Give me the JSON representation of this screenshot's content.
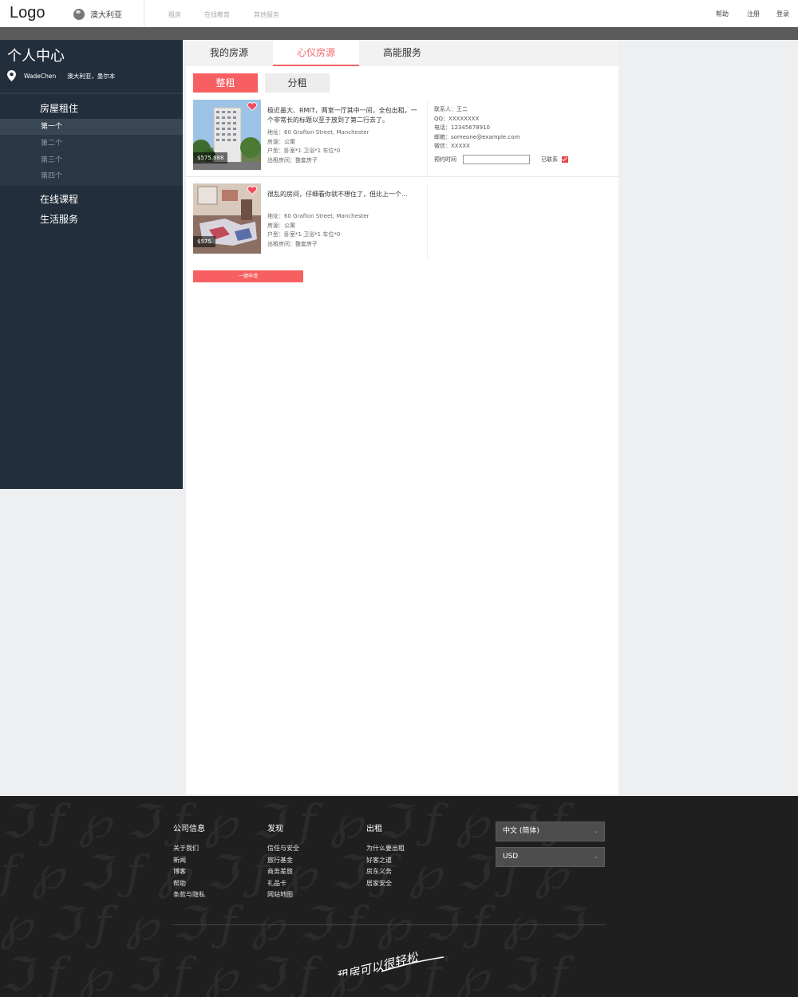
{
  "header": {
    "logo": "Logo",
    "region": "澳大利亚",
    "nav": [
      "租房",
      "在线教育",
      "其他服务"
    ],
    "right_nav": [
      "帮助",
      "注册",
      "登录"
    ]
  },
  "sidebar": {
    "title": "个人中心",
    "username": "WadeChen",
    "location": "澳大利亚，墨尔本",
    "menu": [
      {
        "label": "房屋租住"
      },
      {
        "label": "在线课程"
      },
      {
        "label": "生活服务"
      }
    ],
    "submenu": [
      "第一个",
      "第二个",
      "第三个",
      "第四个"
    ],
    "active_submenu_index": 0
  },
  "tabs": [
    "我的房源",
    "心仪房源",
    "高能服务"
  ],
  "active_tab_index": 1,
  "segments": {
    "whole": "整租",
    "shared": "分租"
  },
  "listings": [
    {
      "price": "$575,888",
      "description": "极近墨大、RMIT，两室一厅其中一间，全包出租，一个非常长的标题以至于放到了第二行去了。",
      "address": "地址：60 Grafton Street, Manchester",
      "source": "房源：公寓",
      "layout": "户型：卧室*1  卫浴*1  车位*0",
      "rent_room": "出租房间：整套房子",
      "favorited": true,
      "contact": {
        "person": "联系人：王二",
        "qq": "QQ：XXXXXXXX",
        "phone": "电话：12345678910",
        "email": "邮箱：someone@example.com",
        "wechat": "微信：XXXXX",
        "booking_label": "预约时间",
        "booking_value": "",
        "contacted_label": "已联系",
        "contacted": true
      }
    },
    {
      "price": "$575",
      "description": "很乱的房间，仔细看你就不想住了，但比上一个...",
      "address": "地址：60 Grafton Street, Manchester",
      "source": "房源：公寓",
      "layout": "户型：卧室*1  卫浴*1  车位*0",
      "rent_room": "出租房间：整套房子",
      "favorited": true
    }
  ],
  "apply_button": "一键申请",
  "footer": {
    "columns": [
      {
        "heading": "公司信息",
        "links": [
          "关于我们",
          "新闻",
          "博客",
          "帮助",
          "条款与隐私"
        ]
      },
      {
        "heading": "发现",
        "links": [
          "信任与安全",
          "旅行基金",
          "商务差旅",
          "礼品卡",
          "网站地图"
        ]
      },
      {
        "heading": "出租",
        "links": [
          "为什么要出租",
          "好客之道",
          "房东义务",
          "居家安全"
        ]
      }
    ],
    "language": "中文 (简体)",
    "currency": "USD",
    "slogan": "租房可以很轻松"
  },
  "colors": {
    "accent": "#f75f61",
    "sidebar_bg": "#222e3b",
    "footer_bg": "#1f1f1f"
  }
}
